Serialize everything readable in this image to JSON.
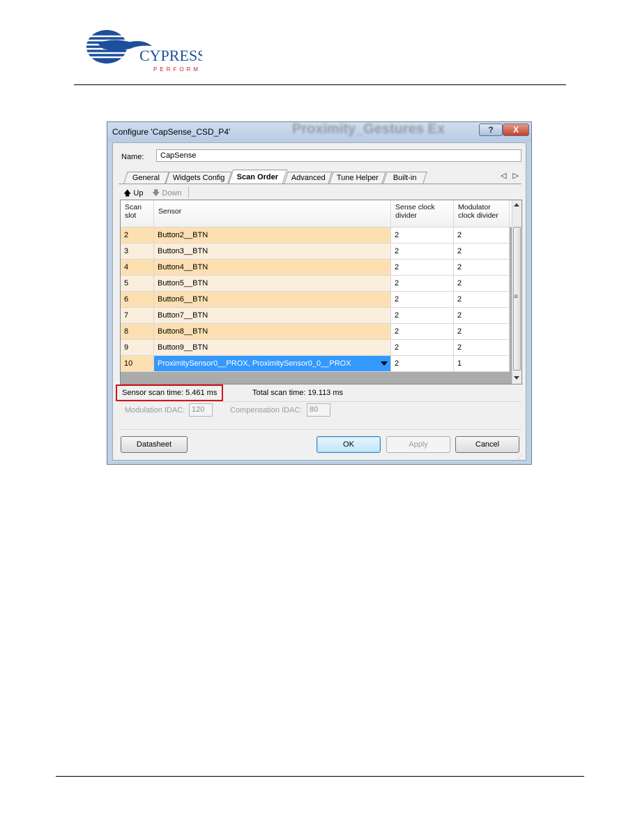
{
  "logo": {
    "brand": "CYPRESS",
    "tagline": "PERFORM"
  },
  "dialog": {
    "title": "Configure 'CapSense_CSD_P4'",
    "background_title": "Proximity_Gestures Ex",
    "help_glyph": "?",
    "close_glyph": "X",
    "name_label": "Name:",
    "name_value": "CapSense",
    "tabs": [
      {
        "label": "General"
      },
      {
        "label": "Widgets Config"
      },
      {
        "label": "Scan Order",
        "active": true
      },
      {
        "label": "Advanced"
      },
      {
        "label": "Tune Helper"
      },
      {
        "label": "Built-in"
      }
    ],
    "tab_scroll": "◁ ▷",
    "toolbar": {
      "up_label": "Up",
      "down_label": "Down"
    },
    "grid": {
      "columns": [
        "Scan slot",
        "Sensor",
        "Sense clock divider",
        "Modulator clock divider"
      ],
      "rows": [
        {
          "slot": "2",
          "sensor": "Button2__BTN",
          "sense": "2",
          "mod": "2"
        },
        {
          "slot": "3",
          "sensor": "Button3__BTN",
          "sense": "2",
          "mod": "2"
        },
        {
          "slot": "4",
          "sensor": "Button4__BTN",
          "sense": "2",
          "mod": "2"
        },
        {
          "slot": "5",
          "sensor": "Button5__BTN",
          "sense": "2",
          "mod": "2"
        },
        {
          "slot": "6",
          "sensor": "Button6__BTN",
          "sense": "2",
          "mod": "2"
        },
        {
          "slot": "7",
          "sensor": "Button7__BTN",
          "sense": "2",
          "mod": "2"
        },
        {
          "slot": "8",
          "sensor": "Button8__BTN",
          "sense": "2",
          "mod": "2"
        },
        {
          "slot": "9",
          "sensor": "Button9__BTN",
          "sense": "2",
          "mod": "2"
        },
        {
          "slot": "10",
          "sensor": "ProximitySensor0__PROX, ProximitySensor0_0__PROX",
          "sense": "2",
          "mod": "1",
          "selected": true
        }
      ]
    },
    "sensor_scan_time": "Sensor scan time:  5.461 ms",
    "total_scan_time": "Total scan time:  19.113 ms",
    "modulation_idac_label": "Modulation IDAC:",
    "modulation_idac_value": "120",
    "compensation_idac_label": "Compensation IDAC:",
    "compensation_idac_value": "80",
    "buttons": {
      "datasheet": "Datasheet",
      "ok": "OK",
      "apply": "Apply",
      "cancel": "Cancel"
    }
  }
}
